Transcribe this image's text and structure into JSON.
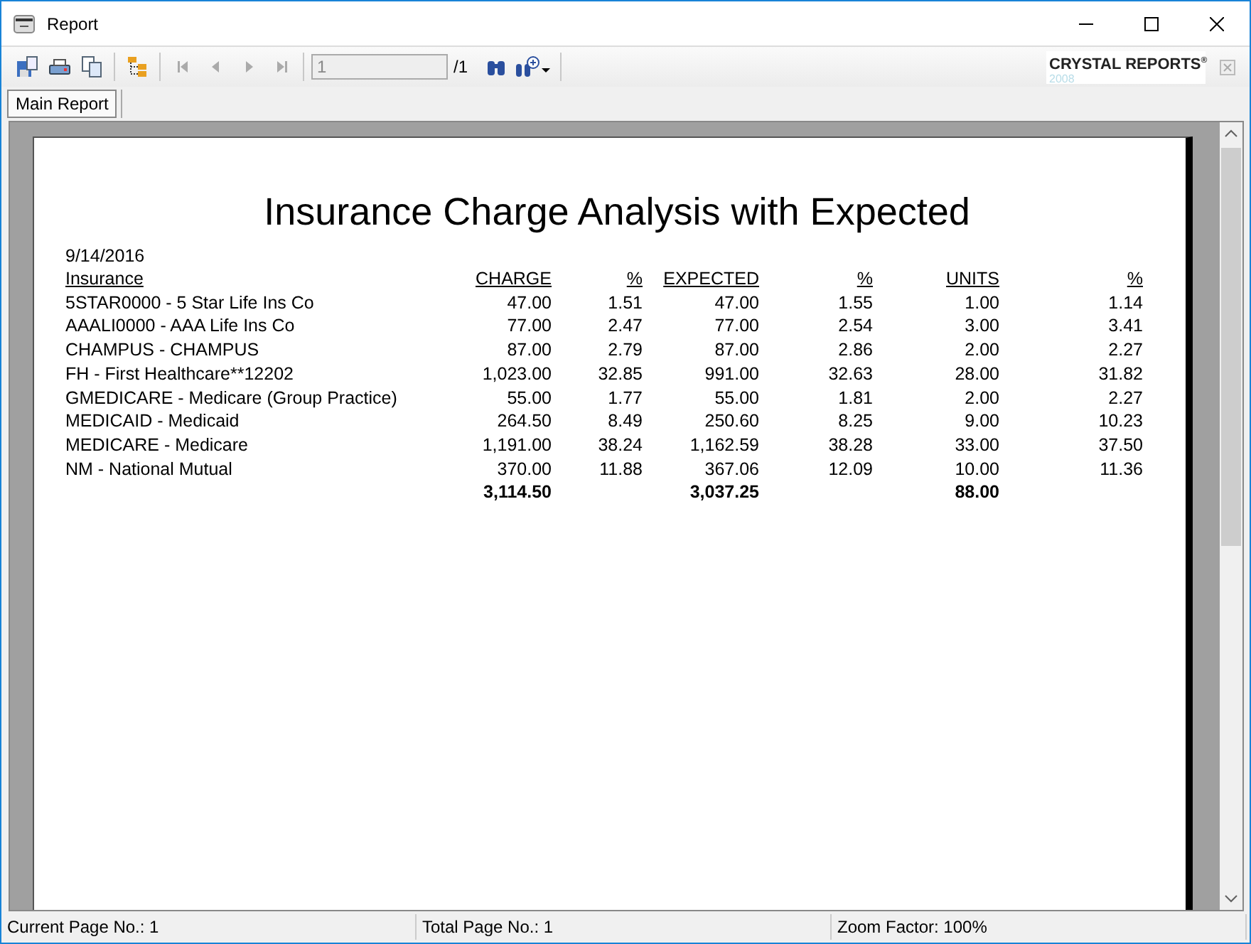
{
  "window": {
    "title": "Report"
  },
  "toolbar": {
    "page_field": {
      "value": "1"
    },
    "page_total": "/1",
    "logo": {
      "name": "CRYSTAL REPORTS",
      "mark": "®",
      "version": "2008"
    }
  },
  "tabs": [
    {
      "label": "Main Report",
      "selected": true
    }
  ],
  "report": {
    "title": "Insurance Charge Analysis with Expected",
    "date": "9/14/2016",
    "columns": [
      "Insurance",
      "CHARGE",
      "%",
      "EXPECTED",
      "%",
      "UNITS",
      "%"
    ],
    "rows": [
      [
        "5STAR0000 - 5 Star Life Ins Co",
        "47.00",
        "1.51",
        "47.00",
        "1.55",
        "1.00",
        "1.14"
      ],
      [
        "AAALI0000 - AAA Life Ins Co",
        "77.00",
        "2.47",
        "77.00",
        "2.54",
        "3.00",
        "3.41"
      ],
      [
        "CHAMPUS - CHAMPUS",
        "87.00",
        "2.79",
        "87.00",
        "2.86",
        "2.00",
        "2.27"
      ],
      [
        "FH - First Healthcare**12202",
        "1,023.00",
        "32.85",
        "991.00",
        "32.63",
        "28.00",
        "31.82"
      ],
      [
        "GMEDICARE - Medicare (Group Practice)",
        "55.00",
        "1.77",
        "55.00",
        "1.81",
        "2.00",
        "2.27"
      ],
      [
        "MEDICAID - Medicaid",
        "264.50",
        "8.49",
        "250.60",
        "8.25",
        "9.00",
        "10.23"
      ],
      [
        "MEDICARE - Medicare",
        "1,191.00",
        "38.24",
        "1,162.59",
        "38.28",
        "33.00",
        "37.50"
      ],
      [
        "NM - National Mutual",
        "370.00",
        "11.88",
        "367.06",
        "12.09",
        "10.00",
        "11.36"
      ]
    ],
    "totals": {
      "charge": "3,114.50",
      "expected": "3,037.25",
      "units": "88.00"
    }
  },
  "status_bar": [
    "Current Page No.: 1",
    "Total Page No.: 1",
    "Zoom Factor: 100%"
  ]
}
